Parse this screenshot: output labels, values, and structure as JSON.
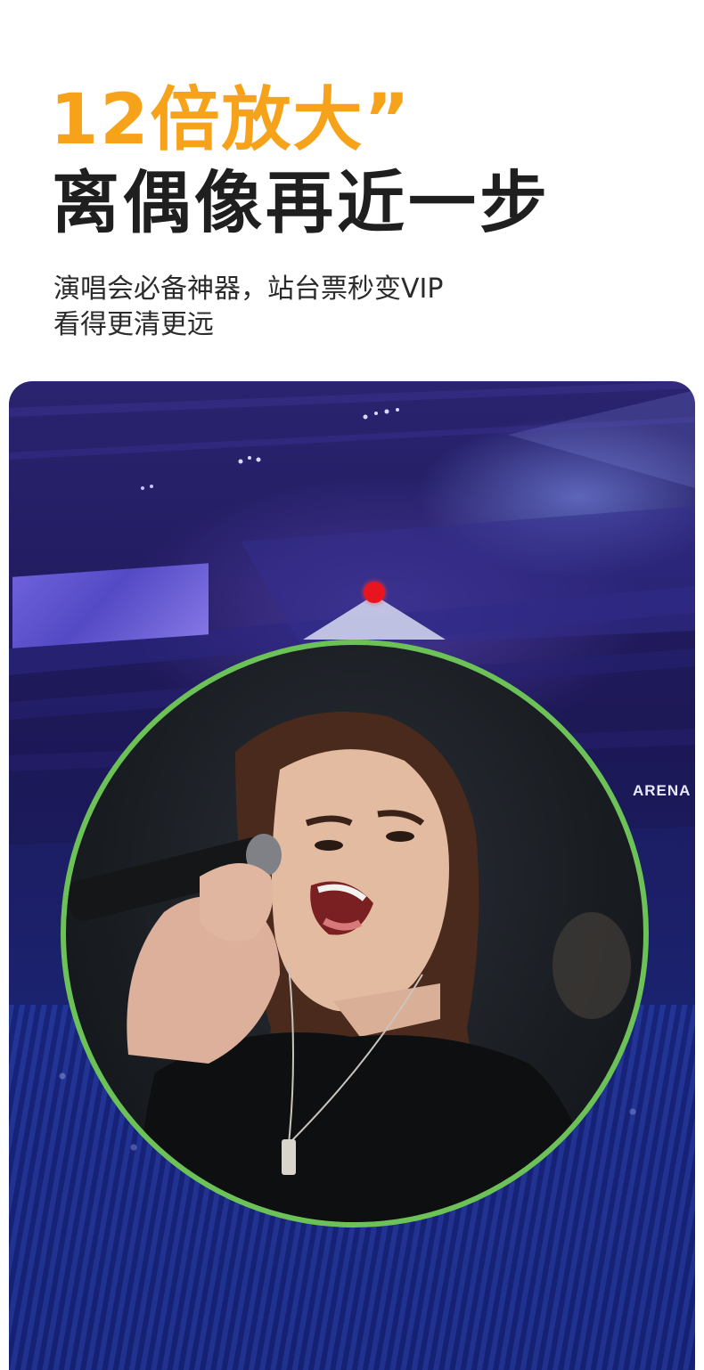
{
  "headline": {
    "zoom": "12倍放大”",
    "main": "离偶像再近一步"
  },
  "subtext": {
    "line1": "演唱会必备神器，站台票秒变VIP",
    "line2": "看得更清更远"
  },
  "photo": {
    "arena_sign": "ARENA"
  },
  "colors": {
    "accent_orange": "#f7a21b",
    "zoom_ring_green": "#6cc257",
    "marker_red": "#e8151f"
  }
}
